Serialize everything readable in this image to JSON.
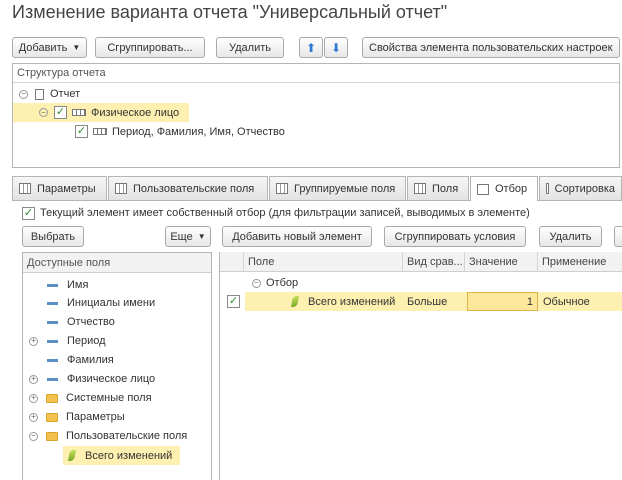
{
  "window": {
    "title": "Изменение варианта отчета \"Универсальный отчет\""
  },
  "toolbar": {
    "add_label": "Добавить",
    "group_label": "Сгруппировать...",
    "delete_label": "Удалить",
    "props_label": "Свойства элемента пользовательских настроек"
  },
  "structure": {
    "header": "Структура отчета",
    "root_label": "Отчет",
    "item1_label": "Физическое лицо",
    "item2_label": "Период, Фамилия, Имя, Отчество"
  },
  "tabs": [
    {
      "label": "Параметры"
    },
    {
      "label": "Пользовательские поля"
    },
    {
      "label": "Группируемые поля"
    },
    {
      "label": "Поля"
    },
    {
      "label": "Отбор"
    },
    {
      "label": "Сортировка"
    }
  ],
  "filter": {
    "own_filter_label": "Текущий элемент имеет собственный отбор (для фильтрации записей, выводимых в элементе)",
    "select_label": "Выбрать",
    "more_label": "Еще",
    "add_new_label": "Добавить новый элемент",
    "group_conditions_label": "Сгруппировать условия",
    "delete_label": "Удалить"
  },
  "available_fields": {
    "header": "Доступные поля",
    "items": [
      {
        "label": "Имя"
      },
      {
        "label": "Инициалы имени"
      },
      {
        "label": "Отчество"
      },
      {
        "label": "Период"
      },
      {
        "label": "Фамилия"
      },
      {
        "label": "Физическое лицо"
      },
      {
        "label": "Системные поля"
      },
      {
        "label": "Параметры"
      },
      {
        "label": "Пользовательские поля"
      },
      {
        "label": "Всего изменений"
      }
    ]
  },
  "grid": {
    "columns": [
      "Поле",
      "Вид срав...",
      "Значение",
      "Применение"
    ],
    "group_label": "Отбор",
    "row": {
      "field": "Всего изменений",
      "comparison": "Больше",
      "value": "1",
      "usage": "Обычное"
    }
  },
  "colors": {
    "highlight": "#fdf0b0",
    "accent": "#2f7bd1"
  }
}
